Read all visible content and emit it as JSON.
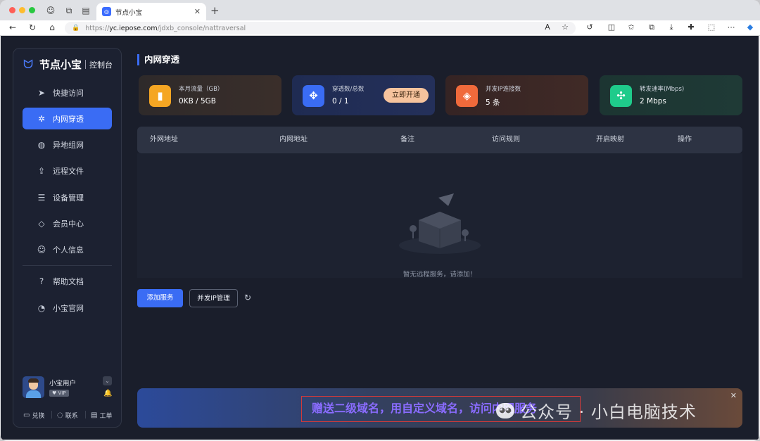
{
  "browser": {
    "tab_title": "节点小宝",
    "url_prefix": "https://",
    "url_domain": "yc.iepose.com",
    "url_path": "/jdxb_console/nattraversal"
  },
  "sidebar": {
    "brand_name": "节点小宝",
    "brand_sub": "控制台",
    "items": [
      {
        "label": "快捷访问",
        "icon": "paper-plane-icon"
      },
      {
        "label": "内网穿透",
        "icon": "network-nodes-icon",
        "active": true
      },
      {
        "label": "异地组网",
        "icon": "globe-icon"
      },
      {
        "label": "远程文件",
        "icon": "folder-upload-icon"
      },
      {
        "label": "设备管理",
        "icon": "server-icon"
      },
      {
        "label": "会员中心",
        "icon": "diamond-icon"
      },
      {
        "label": "个人信息",
        "icon": "user-icon"
      },
      {
        "label": "帮助文档",
        "icon": "help-doc-icon"
      },
      {
        "label": "小宝官网",
        "icon": "pie-chart-icon"
      }
    ],
    "user": {
      "name": "小宝用户",
      "badge": "VIP"
    },
    "footer": [
      {
        "label": "兑换",
        "icon": "ticket-icon"
      },
      {
        "label": "联系",
        "icon": "chat-icon"
      },
      {
        "label": "工单",
        "icon": "document-icon"
      }
    ]
  },
  "main": {
    "title": "内网穿透",
    "cards": [
      {
        "label": "本月流量（GB）",
        "value": "0KB / 5GB",
        "icon": "bar-chart-icon",
        "color": "#f5a623"
      },
      {
        "label": "穿透数/总数",
        "value": "0 / 1",
        "icon": "diamond-grid-icon",
        "color": "#3a6cf4",
        "button": "立即开通"
      },
      {
        "label": "并发IP连接数",
        "value": "5 条",
        "icon": "layers-icon",
        "color": "#f06a3b"
      },
      {
        "label": "转发速率(Mbps)",
        "value": "2 Mbps",
        "icon": "hub-icon",
        "color": "#1fcb8b"
      }
    ],
    "table": {
      "columns": [
        "外网地址",
        "内网地址",
        "备注",
        "访问规则",
        "开启映射",
        "操作"
      ],
      "empty_text": "暂无远程服务，请添加！"
    },
    "actions": {
      "add_service": "添加服务",
      "ip_manage": "并发IP管理"
    },
    "banner": {
      "promo_text": "赠送二级域名，用自定义域名，访问内网服务",
      "watermark": "公众号 · 小白电脑技术"
    }
  }
}
